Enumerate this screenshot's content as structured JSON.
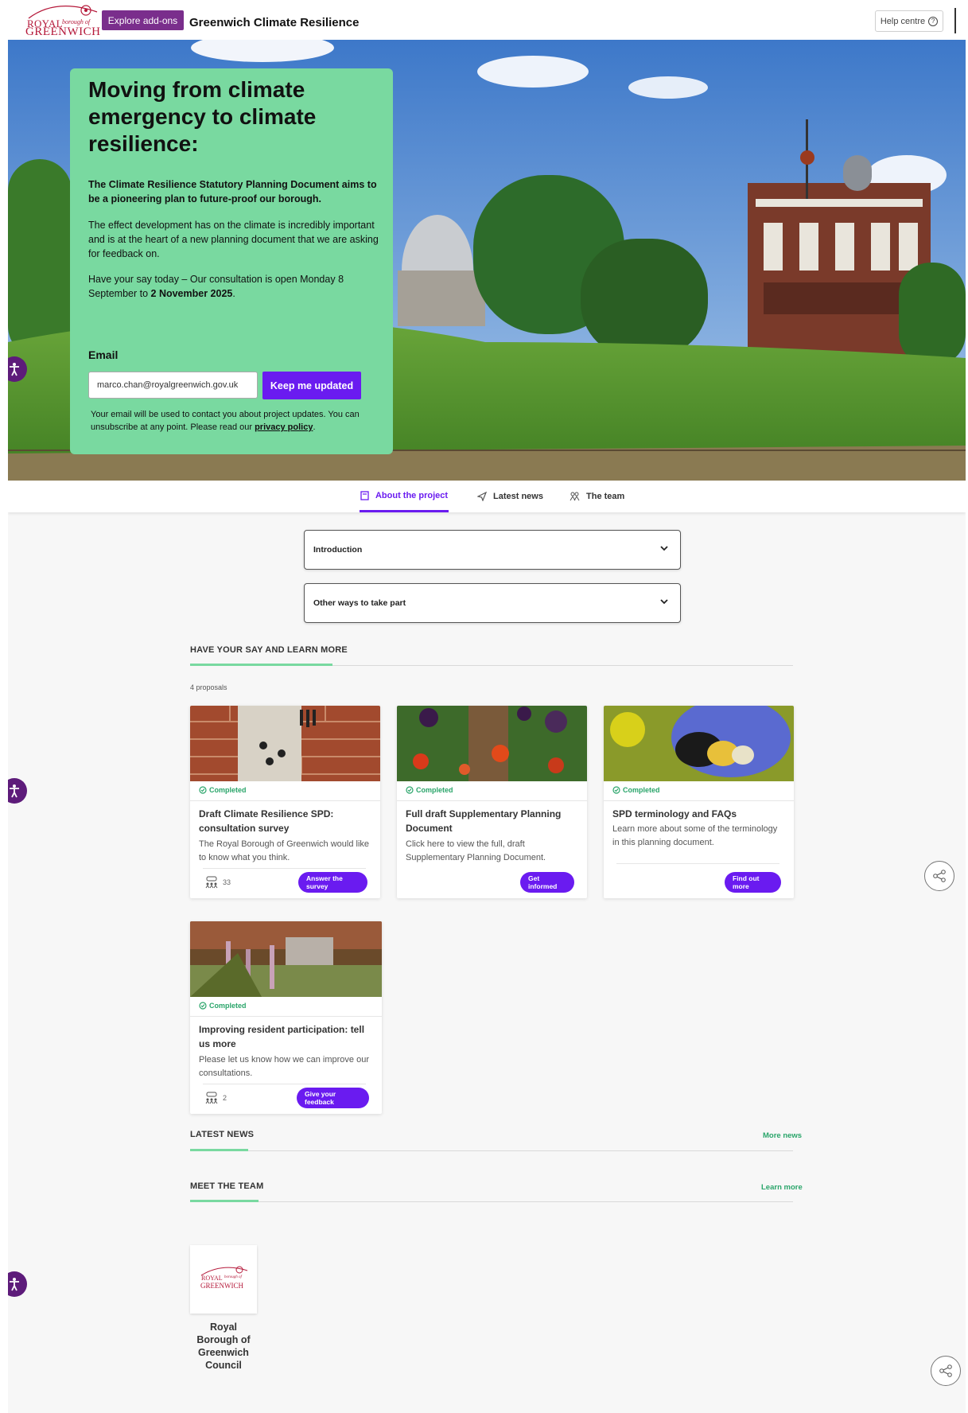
{
  "header": {
    "logo_royal": "ROYAL",
    "logo_borough": "borough of",
    "logo_greenwich": "GREENWICH",
    "explore_label": "Explore add-ons",
    "site_title": "Greenwich Climate Resilience",
    "help_label": "Help centre"
  },
  "hero": {
    "title": "Moving from climate emergency to climate resilience:",
    "lead": "The Climate Resilience Statutory Planning Document aims to be a pioneering plan to future-proof our borough.",
    "paragraph1": "The effect development has on the climate is incredibly important and is at the heart of a new planning document that we are asking for feedback on.",
    "paragraph2_start": "Have your say today – Our consultation is open Monday 8 September to ",
    "paragraph2_bold": "2 November 2025",
    "paragraph2_end": ".",
    "email_label": "Email",
    "email_value": "marco.chan@royalgreenwich.gov.uk",
    "submit_label": "Keep me updated",
    "disclaimer_start": "Your email will be used to contact you about project updates. You can unsubscribe at any point. Please read our ",
    "disclaimer_link": "privacy policy",
    "disclaimer_end": "."
  },
  "tabs": [
    {
      "label": "About the project",
      "icon": "book-icon",
      "active": true
    },
    {
      "label": "Latest news",
      "icon": "send-icon",
      "active": false
    },
    {
      "label": "The team",
      "icon": "team-icon",
      "active": false
    }
  ],
  "accordions": [
    {
      "label": "Introduction"
    },
    {
      "label": "Other ways to take part"
    }
  ],
  "proposals": {
    "heading": "HAVE YOUR SAY AND LEARN MORE",
    "count": "4 proposals",
    "cards": [
      {
        "status": "Completed",
        "title": "Draft Climate Resilience SPD: consultation survey",
        "description": "The Royal Borough of Greenwich would like to know what you think.",
        "participants": "33",
        "button": "Answer the survey"
      },
      {
        "status": "Completed",
        "title": "Full draft Supplementary Planning Document",
        "description": "Click here to view the full, draft Supplementary Planning Document.",
        "button": "Get informed"
      },
      {
        "status": "Completed",
        "title": "SPD terminology and FAQs",
        "description": "Learn more about some of the terminology in this planning document.",
        "button": "Find out more"
      },
      {
        "status": "Completed",
        "title": "Improving resident participation: tell us more",
        "description": "Please let us know how we can improve our consultations.",
        "participants": "2",
        "button": "Give your feedback"
      }
    ]
  },
  "news": {
    "heading": "LATEST NEWS",
    "link": "More news"
  },
  "team": {
    "heading": "MEET THE TEAM",
    "link": "Learn more",
    "logo_royal": "ROYAL",
    "logo_borough": "borough of",
    "logo_greenwich": "GREENWICH",
    "member_name": "Royal Borough of Greenwich Council"
  },
  "colors": {
    "accent_purple": "#6a1bf0",
    "hero_card_green": "#79d9a0",
    "brand_red": "#b5193a",
    "explore_purple": "#7a2e8c",
    "status_green": "#2aa56a"
  }
}
